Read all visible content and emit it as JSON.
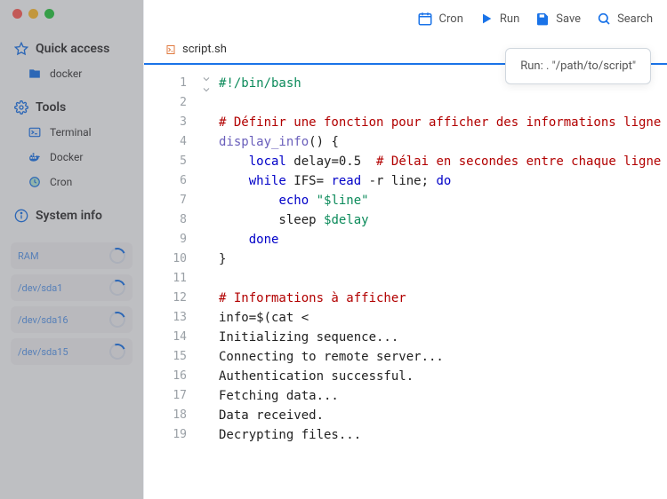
{
  "sidebar": {
    "sections": [
      {
        "title": "Quick access",
        "icon": "star-icon",
        "items": [
          {
            "label": "docker",
            "icon": "folder-icon"
          }
        ]
      },
      {
        "title": "Tools",
        "icon": "tools-icon",
        "items": [
          {
            "label": "Terminal",
            "icon": "terminal-icon"
          },
          {
            "label": "Docker",
            "icon": "docker-icon"
          },
          {
            "label": "Cron",
            "icon": "clock-icon"
          }
        ]
      },
      {
        "title": "System info",
        "icon": "info-icon",
        "metrics": [
          {
            "label": "RAM"
          },
          {
            "label": "/dev/sda1"
          },
          {
            "label": "/dev/sda16"
          },
          {
            "label": "/dev/sda15"
          }
        ]
      }
    ]
  },
  "toolbar": {
    "buttons": [
      {
        "label": "Cron",
        "icon": "calendar-icon"
      },
      {
        "label": "Run",
        "icon": "play-icon"
      },
      {
        "label": "Save",
        "icon": "save-icon"
      },
      {
        "label": "Search",
        "icon": "search-icon"
      }
    ]
  },
  "tab": {
    "filename": "script.sh"
  },
  "tooltip": {
    "text": "Run: . \"/path/to/script\""
  },
  "code": {
    "lines": [
      {
        "n": 1,
        "kind": "hash",
        "text": "#!/bin/bash",
        "fold": false
      },
      {
        "n": 2,
        "kind": "plain",
        "text": "",
        "fold": false
      },
      {
        "n": 3,
        "kind": "comment",
        "text": "# Définir une fonction pour afficher des informations ligne par ligne",
        "fold": false
      },
      {
        "n": 4,
        "kind": "funcdecl",
        "text": "display_info() {",
        "fold": true
      },
      {
        "n": 5,
        "kind": "local",
        "text": "    local delay=0.5  # Délai en secondes entre chaque ligne",
        "fold": false
      },
      {
        "n": 6,
        "kind": "while",
        "text": "    while IFS= read -r line; do",
        "fold": false
      },
      {
        "n": 7,
        "kind": "echo",
        "text": "        echo \"$line\"",
        "fold": false
      },
      {
        "n": 8,
        "kind": "sleep",
        "text": "        sleep $delay",
        "fold": false
      },
      {
        "n": 9,
        "kind": "kw",
        "text": "    done",
        "fold": false
      },
      {
        "n": 10,
        "kind": "plain",
        "text": "}",
        "fold": false
      },
      {
        "n": 11,
        "kind": "plain",
        "text": "",
        "fold": false
      },
      {
        "n": 12,
        "kind": "comment",
        "text": "# Informations à afficher",
        "fold": false
      },
      {
        "n": 13,
        "kind": "plain",
        "text": "info=$(cat <<EOF",
        "fold": true
      },
      {
        "n": 14,
        "kind": "plain",
        "text": "Initializing sequence...",
        "fold": false
      },
      {
        "n": 15,
        "kind": "plain",
        "text": "Connecting to remote server...",
        "fold": false
      },
      {
        "n": 16,
        "kind": "plain",
        "text": "Authentication successful.",
        "fold": false
      },
      {
        "n": 17,
        "kind": "plain",
        "text": "Fetching data...",
        "fold": false
      },
      {
        "n": 18,
        "kind": "plain",
        "text": "Data received.",
        "fold": false
      },
      {
        "n": 19,
        "kind": "plain",
        "text": "Decrypting files...",
        "fold": false
      }
    ]
  }
}
